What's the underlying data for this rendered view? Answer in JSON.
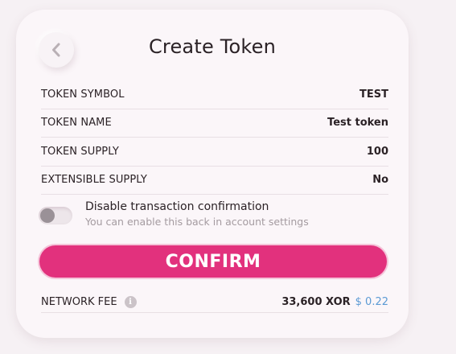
{
  "header": {
    "title": "Create Token"
  },
  "details": [
    {
      "label": "TOKEN SYMBOL",
      "value": "TEST"
    },
    {
      "label": "TOKEN NAME",
      "value": "Test token"
    },
    {
      "label": "TOKEN SUPPLY",
      "value": "100"
    },
    {
      "label": "EXTENSIBLE SUPPLY",
      "value": "No"
    }
  ],
  "confirmation_toggle": {
    "title": "Disable transaction confirmation",
    "subtitle": "You can enable this back in account settings",
    "enabled": false
  },
  "confirm_button": {
    "label": "CONFIRM"
  },
  "network_fee": {
    "label": "NETWORK FEE",
    "info_icon": "i",
    "amount": "33,600 XOR",
    "usd": "$ 0.22"
  },
  "colors": {
    "accent": "#e2317d",
    "usd_text": "#5b9ad4"
  }
}
